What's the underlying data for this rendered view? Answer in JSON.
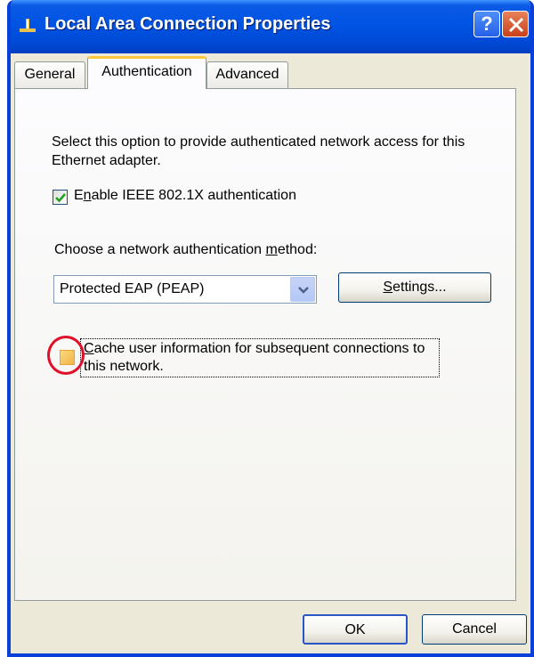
{
  "window": {
    "title": "Local Area Connection Properties",
    "help_label": "?"
  },
  "tabs": {
    "general": "General",
    "authentication": "Authentication",
    "advanced": "Advanced"
  },
  "auth": {
    "description": "Select this option to provide authenticated network access for this Ethernet adapter.",
    "enable_label_pre": "E",
    "enable_label_underlined": "n",
    "enable_label_post": "able IEEE 802.1X authentication",
    "enable_checked": true,
    "choose_label_pre": "Choose a network authentication ",
    "choose_label_underlined": "m",
    "choose_label_post": "ethod:",
    "method_selected": "Protected EAP (PEAP)",
    "settings_underlined": "S",
    "settings_post": "ettings...",
    "cache_label_underlined": "C",
    "cache_label_post": "ache user information for subsequent connections to this network.",
    "cache_checked": false
  },
  "buttons": {
    "ok": "OK",
    "cancel": "Cancel"
  },
  "colors": {
    "titlebar": "#0054e3",
    "dialog_bg": "#ece9d8",
    "active_tab_accent": "#ffc83c",
    "annotation_circle": "#e0102a",
    "checkmark": "#21a121"
  }
}
